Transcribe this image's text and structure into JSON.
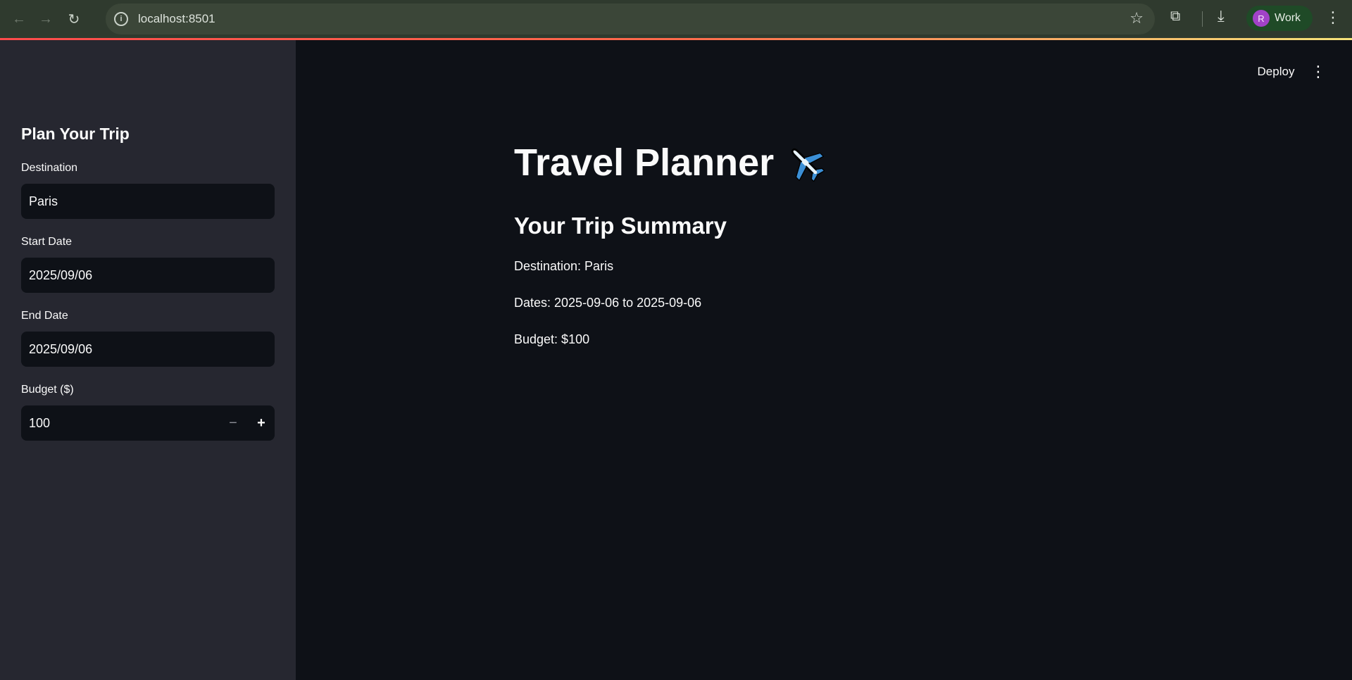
{
  "browser": {
    "url": "localhost:8501",
    "profile_initial": "R",
    "profile_name": "Work"
  },
  "sidebar": {
    "title": "Plan Your Trip",
    "destination": {
      "label": "Destination",
      "value": "Paris"
    },
    "start_date": {
      "label": "Start Date",
      "value": "2025/09/06"
    },
    "end_date": {
      "label": "End Date",
      "value": "2025/09/06"
    },
    "budget": {
      "label": "Budget ($)",
      "value": "100",
      "minus": "−",
      "plus": "+"
    }
  },
  "header": {
    "deploy_label": "Deploy"
  },
  "main": {
    "title": "Travel Planner",
    "summary_heading": "Your Trip Summary",
    "destination_line": "Destination: Paris",
    "dates_line": "Dates: 2025-09-06 to 2025-09-06",
    "budget_line": "Budget: $100"
  },
  "colors": {
    "app_background": "#0e1117",
    "sidebar_background": "#262730",
    "input_background": "#0e1117",
    "text": "#fafafa",
    "browser_bar": "#2f3a2e",
    "accent": "#ff4b4b"
  },
  "icons": {
    "title_emoji": "airplane-icon"
  }
}
